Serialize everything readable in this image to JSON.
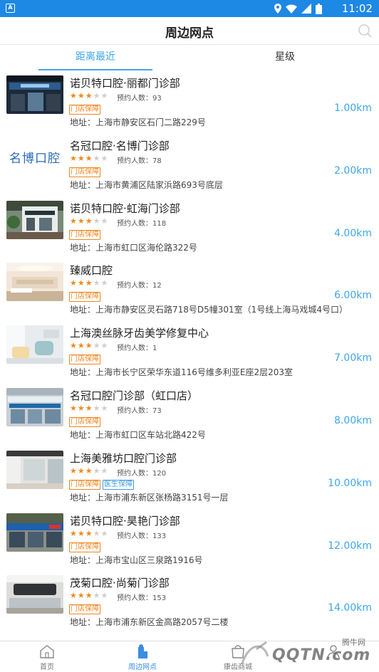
{
  "statusbar": {
    "time": "11:02"
  },
  "header": {
    "title": "周边网点"
  },
  "tabs": [
    {
      "label": "距离最近"
    },
    {
      "label": "星级"
    }
  ],
  "clinics": [
    {
      "name": "诺贝特口腔·丽都门诊部",
      "rating": 3,
      "booking_label": "预约人数：93",
      "badges": [
        "门店保障"
      ],
      "address": "地址：上海市静安区石门二路229号",
      "distance": "1.00km"
    },
    {
      "name": "名冠口腔·名博门诊部",
      "rating": 3,
      "booking_label": "预约人数：78",
      "badges": [
        "门店保障"
      ],
      "address": "地址：上海市黄浦区陆家浜路693号底层",
      "distance": "2.00km",
      "logo_text": "名博口腔"
    },
    {
      "name": "诺贝特口腔·虹海门诊部",
      "rating": 3,
      "booking_label": "预约人数：118",
      "badges": [
        "门店保障"
      ],
      "address": "地址：上海市虹口区海伦路322号",
      "distance": "4.00km"
    },
    {
      "name": "臻威口腔",
      "rating": 3,
      "booking_label": "预约人数：12",
      "badges": [
        "门店保障"
      ],
      "address": "地址：上海市静安区灵石路718号D5幢301室（1号线上海马戏城4号口）",
      "distance": "6.00km"
    },
    {
      "name": "上海澳丝脉牙齿美学修复中心",
      "rating": 3,
      "booking_label": "预约人数：1",
      "badges": [
        "门店保障"
      ],
      "address": "地址：上海市长宁区荣华东道116号维多利亚E座2层203室",
      "distance": "7.00km"
    },
    {
      "name": "名冠口腔门诊部（虹口店）",
      "rating": 3,
      "booking_label": "预约人数：73",
      "badges": [
        "门店保障"
      ],
      "address": "地址：上海市虹口区车站北路422号",
      "distance": "8.00km"
    },
    {
      "name": "上海美雅坊口腔门诊部",
      "rating": 3,
      "booking_label": "预约人数：120",
      "badges": [
        "门店保障",
        "医生保障"
      ],
      "address": "地址：上海市浦东新区张杨路3151号一层",
      "distance": "10.00km"
    },
    {
      "name": "诺贝特口腔·昊艳门诊部",
      "rating": 3,
      "booking_label": "预约人数：133",
      "badges": [
        "门店保障"
      ],
      "address": "地址：上海市宝山区三泉路1916号",
      "distance": "12.00km"
    },
    {
      "name": "茂菊口腔·尚菊门诊部",
      "rating": 3,
      "booking_label": "预约人数：153",
      "badges": [
        "门店保障"
      ],
      "address": "地址：上海市浦东新区金高路2057号二楼",
      "distance": "14.00km"
    }
  ],
  "bottom_nav": [
    {
      "label": "首页",
      "icon": "home-icon"
    },
    {
      "label": "周边网点",
      "icon": "clinic-location-icon"
    },
    {
      "label": "康齿商城",
      "icon": "store-icon"
    },
    {
      "label": "",
      "icon": "profile-icon"
    }
  ],
  "watermark": {
    "text": "腾牛网",
    "logo_text": "QQTN.com"
  },
  "colors": {
    "status_bar": "#1e88e5",
    "accent": "#3ea6e8",
    "star": "#f08a1c",
    "badge_orange": "#f0841e",
    "badge_blue": "#3a9ae6"
  }
}
